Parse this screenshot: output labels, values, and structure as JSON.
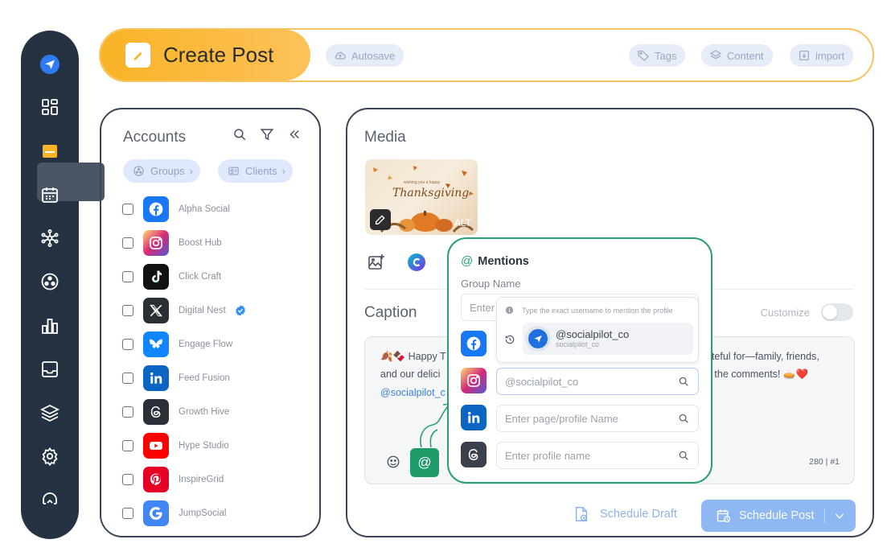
{
  "top_bar": {
    "title": "Create Post",
    "chips": {
      "autosave": "Autosave",
      "tags": "Tags",
      "content": "Content",
      "import": "import"
    }
  },
  "sidebar": {
    "items": [
      "logo-icon",
      "dashboard-icon",
      "create-post-icon",
      "calendar-icon",
      "network-icon",
      "groups-icon",
      "analytics-icon",
      "inbox-icon",
      "layers-icon",
      "settings-icon",
      "support-icon"
    ],
    "active_index": 2
  },
  "accounts": {
    "title": "Accounts",
    "filters": {
      "groups": "Groups",
      "clients": "Clients"
    },
    "list": [
      {
        "name": "Alpha Social",
        "network": "facebook",
        "color": "#1877f2"
      },
      {
        "name": "Boost Hub",
        "network": "instagram",
        "color": "#e1306c"
      },
      {
        "name": "Click Craft",
        "network": "tiktok",
        "color": "#111111"
      },
      {
        "name": "Digital Nest",
        "network": "x",
        "color": "#2a2f35",
        "verified": true
      },
      {
        "name": "Engage Flow",
        "network": "bluesky",
        "color": "#1185fe"
      },
      {
        "name": "Feed Fusion",
        "network": "linkedin",
        "color": "#0a66c2"
      },
      {
        "name": "Growth Hive",
        "network": "threads",
        "color": "#2b3038"
      },
      {
        "name": "Hype Studio",
        "network": "youtube",
        "color": "#ff0000"
      },
      {
        "name": "InspireGrid",
        "network": "pinterest",
        "color": "#e60023"
      },
      {
        "name": "JumpSocial",
        "network": "google",
        "color": "#4285f4"
      }
    ]
  },
  "media": {
    "title": "Media",
    "thumbnail": {
      "small_text": "wishing you a happy",
      "text": "Thanksgiving",
      "alt_label": "ALT"
    }
  },
  "caption": {
    "label": "Caption",
    "customize": "Customize",
    "line1_left": "🍂🍫 Happy T",
    "line1_right": "ateful for—family, friends,",
    "line2_left": "and our delici",
    "line2_right": "n the comments! 🥧❤️",
    "mention": "@socialpilot_c",
    "counter": "280 | #1"
  },
  "actions": {
    "schedule_draft": "Schedule Draft",
    "schedule_post": "Schedule Post"
  },
  "mentions_popup": {
    "title": "Mentions",
    "group_label": "Group Name",
    "group_placeholder": "Enter",
    "hint": "Type the exact username to mention the profile",
    "suggestion": {
      "handle": "@socialpilot_co",
      "sub": "socialpilot_co"
    },
    "instagram_value": "@socialpilot_co",
    "linkedin_placeholder": "Enter page/profile Name",
    "threads_placeholder": "Enter profile name"
  },
  "colors": {
    "accent": "#f9b326",
    "brand_green": "#2aa06e",
    "sidebar": "#253242",
    "primary_blue": "#8db8f2"
  }
}
